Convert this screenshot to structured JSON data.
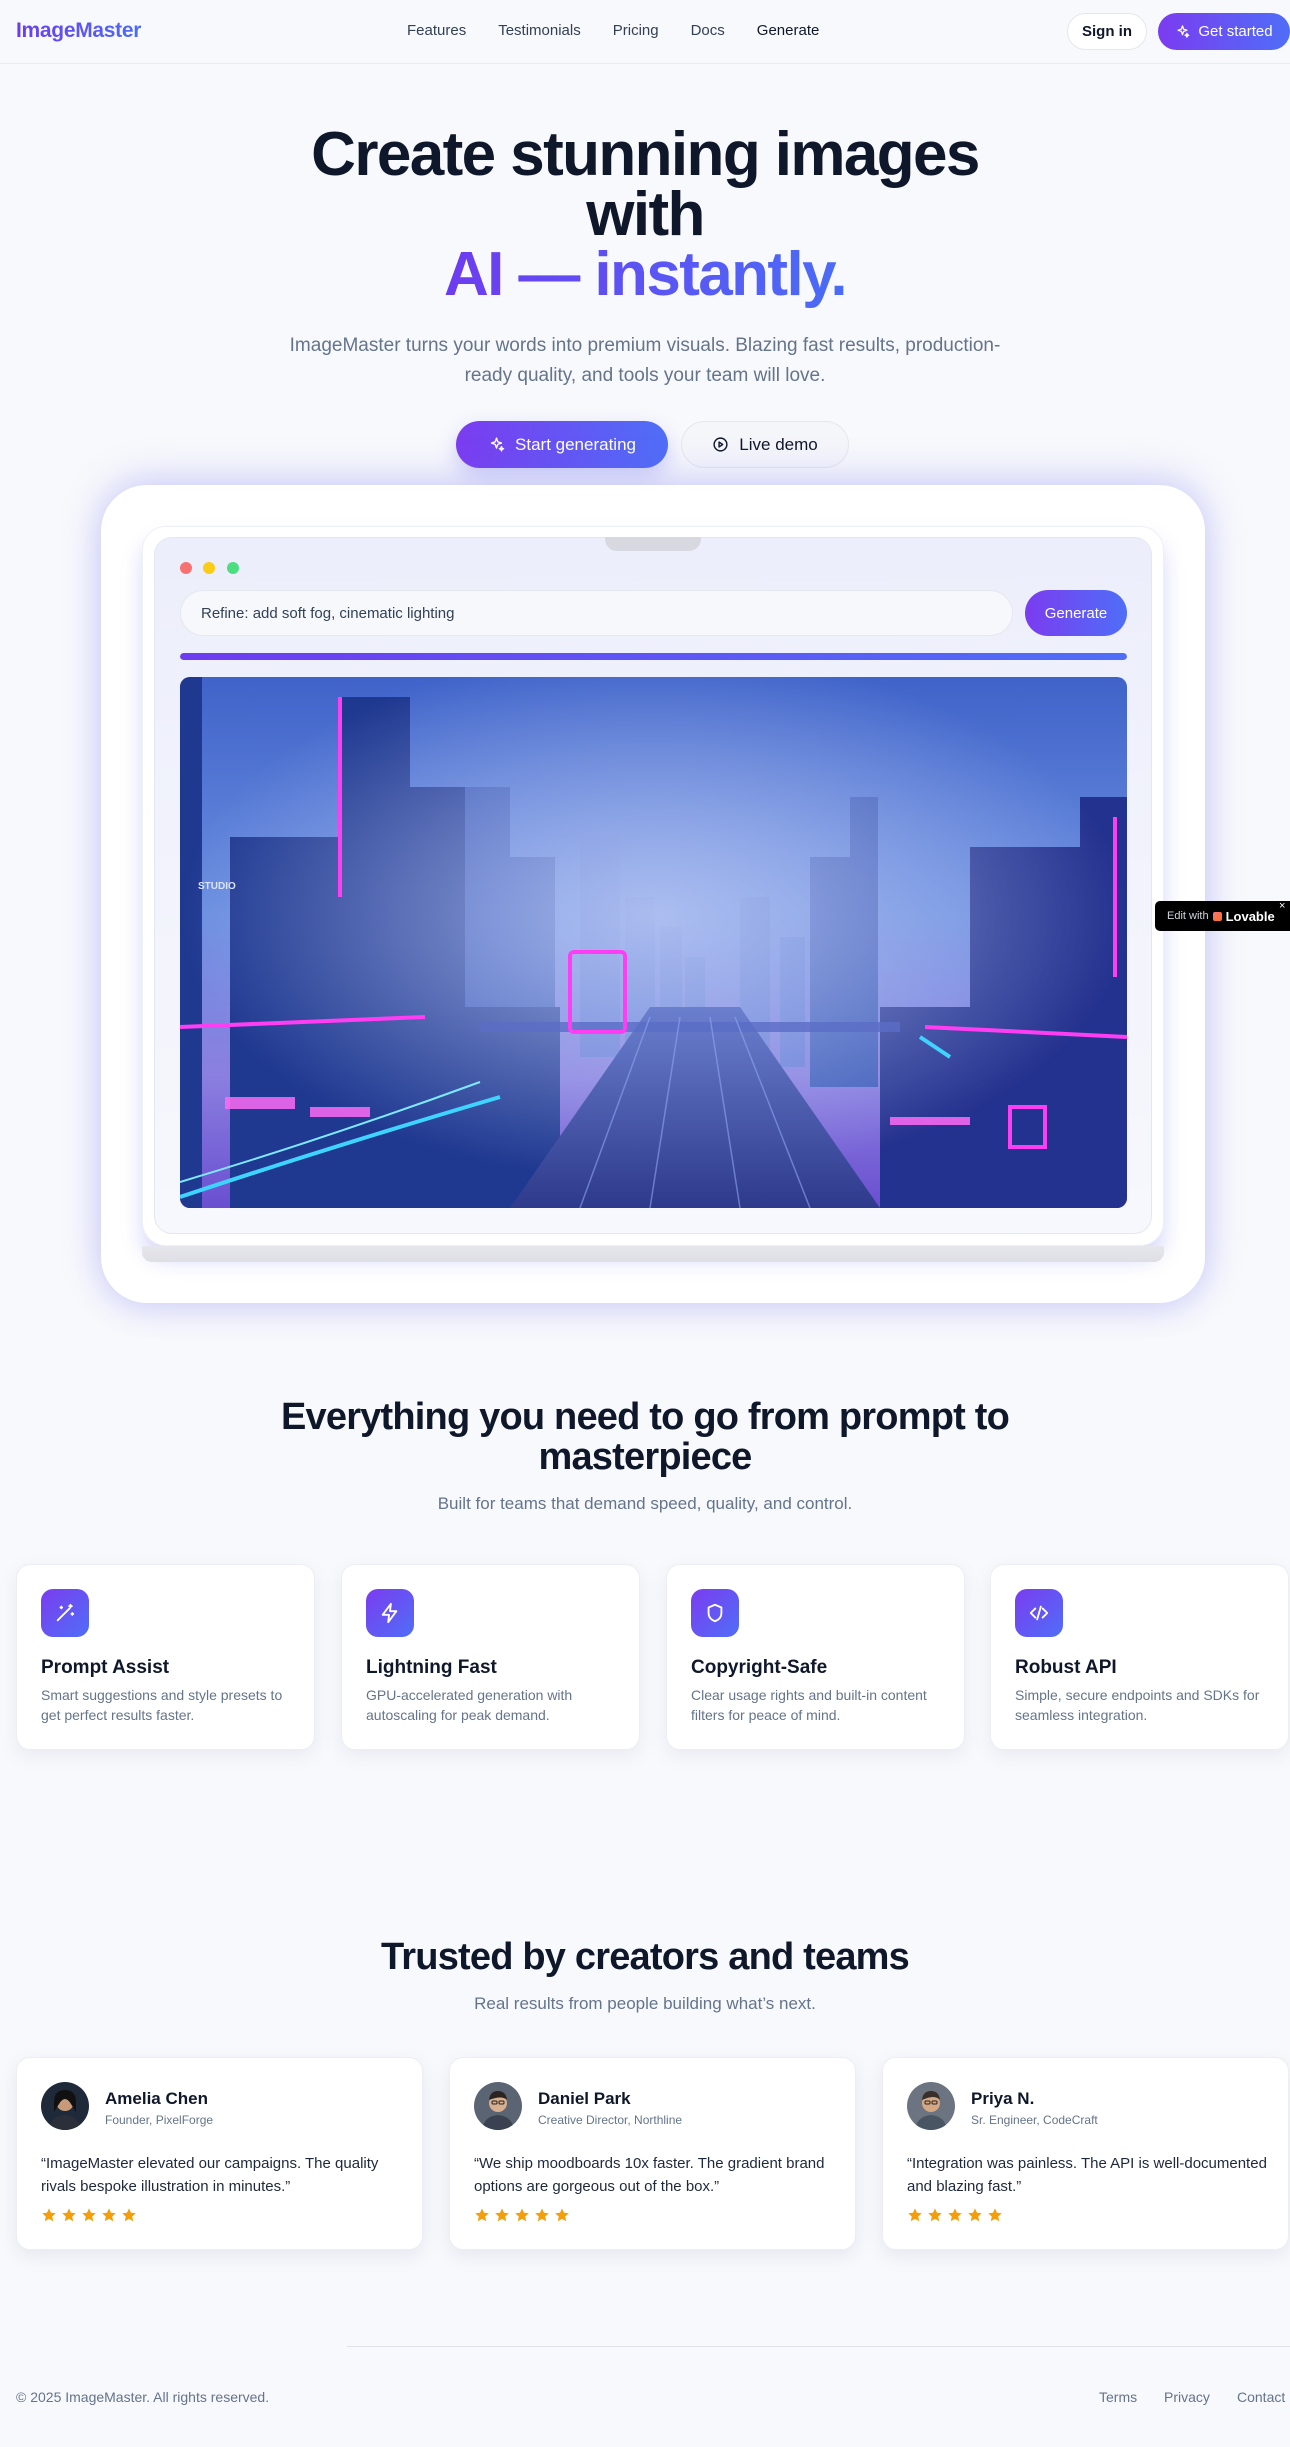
{
  "nav": {
    "logo": "ImageMaster",
    "links": [
      "Features",
      "Testimonials",
      "Pricing",
      "Docs",
      "Generate"
    ],
    "sign_in": "Sign in",
    "get_started": "Get started"
  },
  "hero": {
    "title_line1": "Create stunning images",
    "title_line2": "with",
    "title_accent": "AI — instantly.",
    "subtitle": "ImageMaster turns your words into premium visuals. Blazing fast results, production-ready quality, and tools your team will love.",
    "primary_cta": "Start generating",
    "secondary_cta": "Live demo"
  },
  "demo": {
    "prompt_value": "Refine: add soft fog, cinematic lighting",
    "generate_label": "Generate",
    "progress": 1.0,
    "image_sign_text": "STUDIO"
  },
  "lovable": {
    "edit": "Edit with",
    "brand": "Lovable",
    "close": "×"
  },
  "features": {
    "title": "Everything you need to go from prompt to masterpiece",
    "subtitle": "Built for teams that demand speed, quality, and control.",
    "items": [
      {
        "icon": "magic-wand-icon",
        "name": "Prompt Assist",
        "desc": "Smart suggestions and style presets to get perfect results faster."
      },
      {
        "icon": "lightning-icon",
        "name": "Lightning Fast",
        "desc": "GPU-accelerated generation with autoscaling for peak demand."
      },
      {
        "icon": "shield-icon",
        "name": "Copyright-Safe",
        "desc": "Clear usage rights and built-in content filters for peace of mind."
      },
      {
        "icon": "code-icon",
        "name": "Robust API",
        "desc": "Simple, secure endpoints and SDKs for seamless integration."
      }
    ]
  },
  "testimonials": {
    "title": "Trusted by creators and teams",
    "subtitle": "Real results from people building what’s next.",
    "items": [
      {
        "name": "Amelia Chen",
        "role": "Founder, PixelForge",
        "quote": "“ImageMaster elevated our campaigns. The quality rivals bespoke illustration in minutes.”",
        "rating": 5
      },
      {
        "name": "Daniel Park",
        "role": "Creative Director, Northline",
        "quote": "“We ship moodboards 10x faster. The gradient brand options are gorgeous out of the box.”",
        "rating": 5
      },
      {
        "name": "Priya N.",
        "role": "Sr. Engineer, CodeCraft",
        "quote": "“Integration was painless. The API is well-documented and blazing fast.”",
        "rating": 5
      }
    ]
  },
  "footer": {
    "copyright": "© 2025 ImageMaster. All rights reserved.",
    "links": [
      "Terms",
      "Privacy",
      "Contact"
    ]
  },
  "colors": {
    "accent_purple": "#7b3cf0",
    "accent_blue": "#4f6ef7",
    "text_dark": "#0f172a",
    "text_muted": "#64748b",
    "star": "#f59e0b",
    "background": "#f8f9fc"
  }
}
